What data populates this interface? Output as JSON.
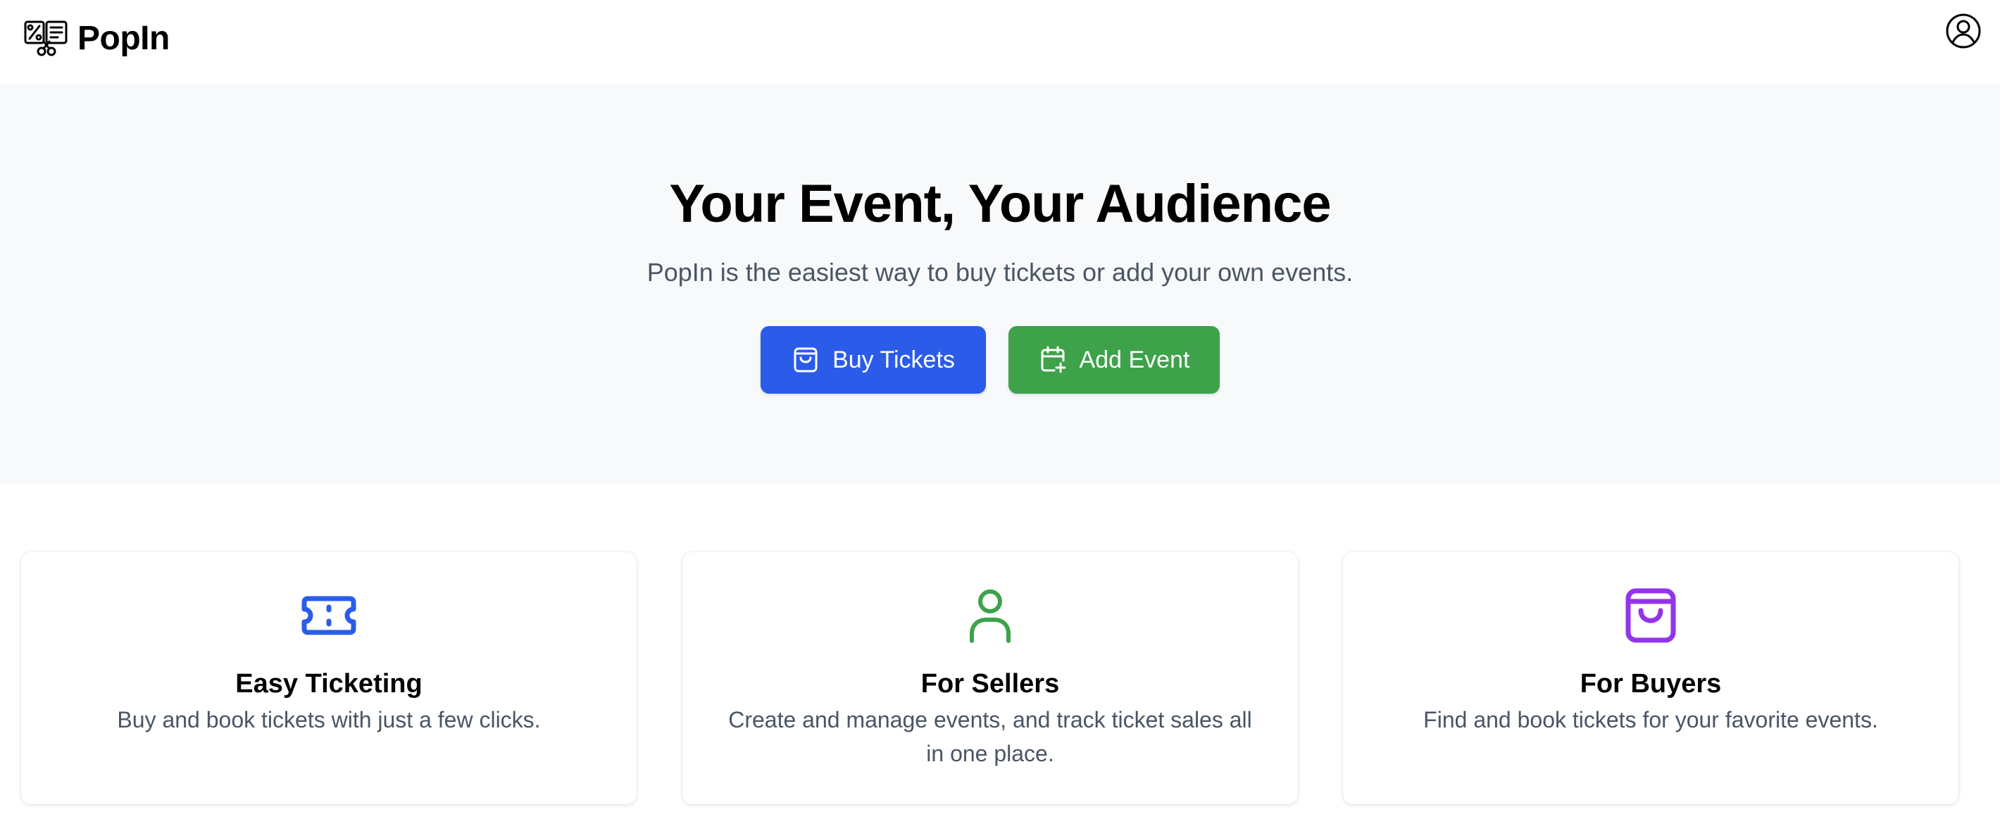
{
  "header": {
    "brand_name": "PopIn",
    "logo_icon": "ticket-scissors-logo",
    "profile_icon": "user-circle-icon"
  },
  "hero": {
    "title": "Your Event, Your Audience",
    "subtitle": "PopIn is the easiest way to buy tickets or add your own events.",
    "buy_label": "Buy Tickets",
    "add_label": "Add Event",
    "buy_color": "#2b5ce9",
    "add_color": "#3da24a",
    "background": "#f8f9fb"
  },
  "features": [
    {
      "icon": "ticket-icon",
      "icon_color": "#2b5ce9",
      "title": "Easy Ticketing",
      "text": "Buy and book tickets with just a few clicks."
    },
    {
      "icon": "user-icon",
      "icon_color": "#3da24a",
      "title": "For Sellers",
      "text": "Create and manage events, and track ticket sales all in one place."
    },
    {
      "icon": "shopping-bag-icon",
      "icon_color": "#9333ea",
      "title": "For Buyers",
      "text": "Find and book tickets for your favorite events."
    }
  ]
}
